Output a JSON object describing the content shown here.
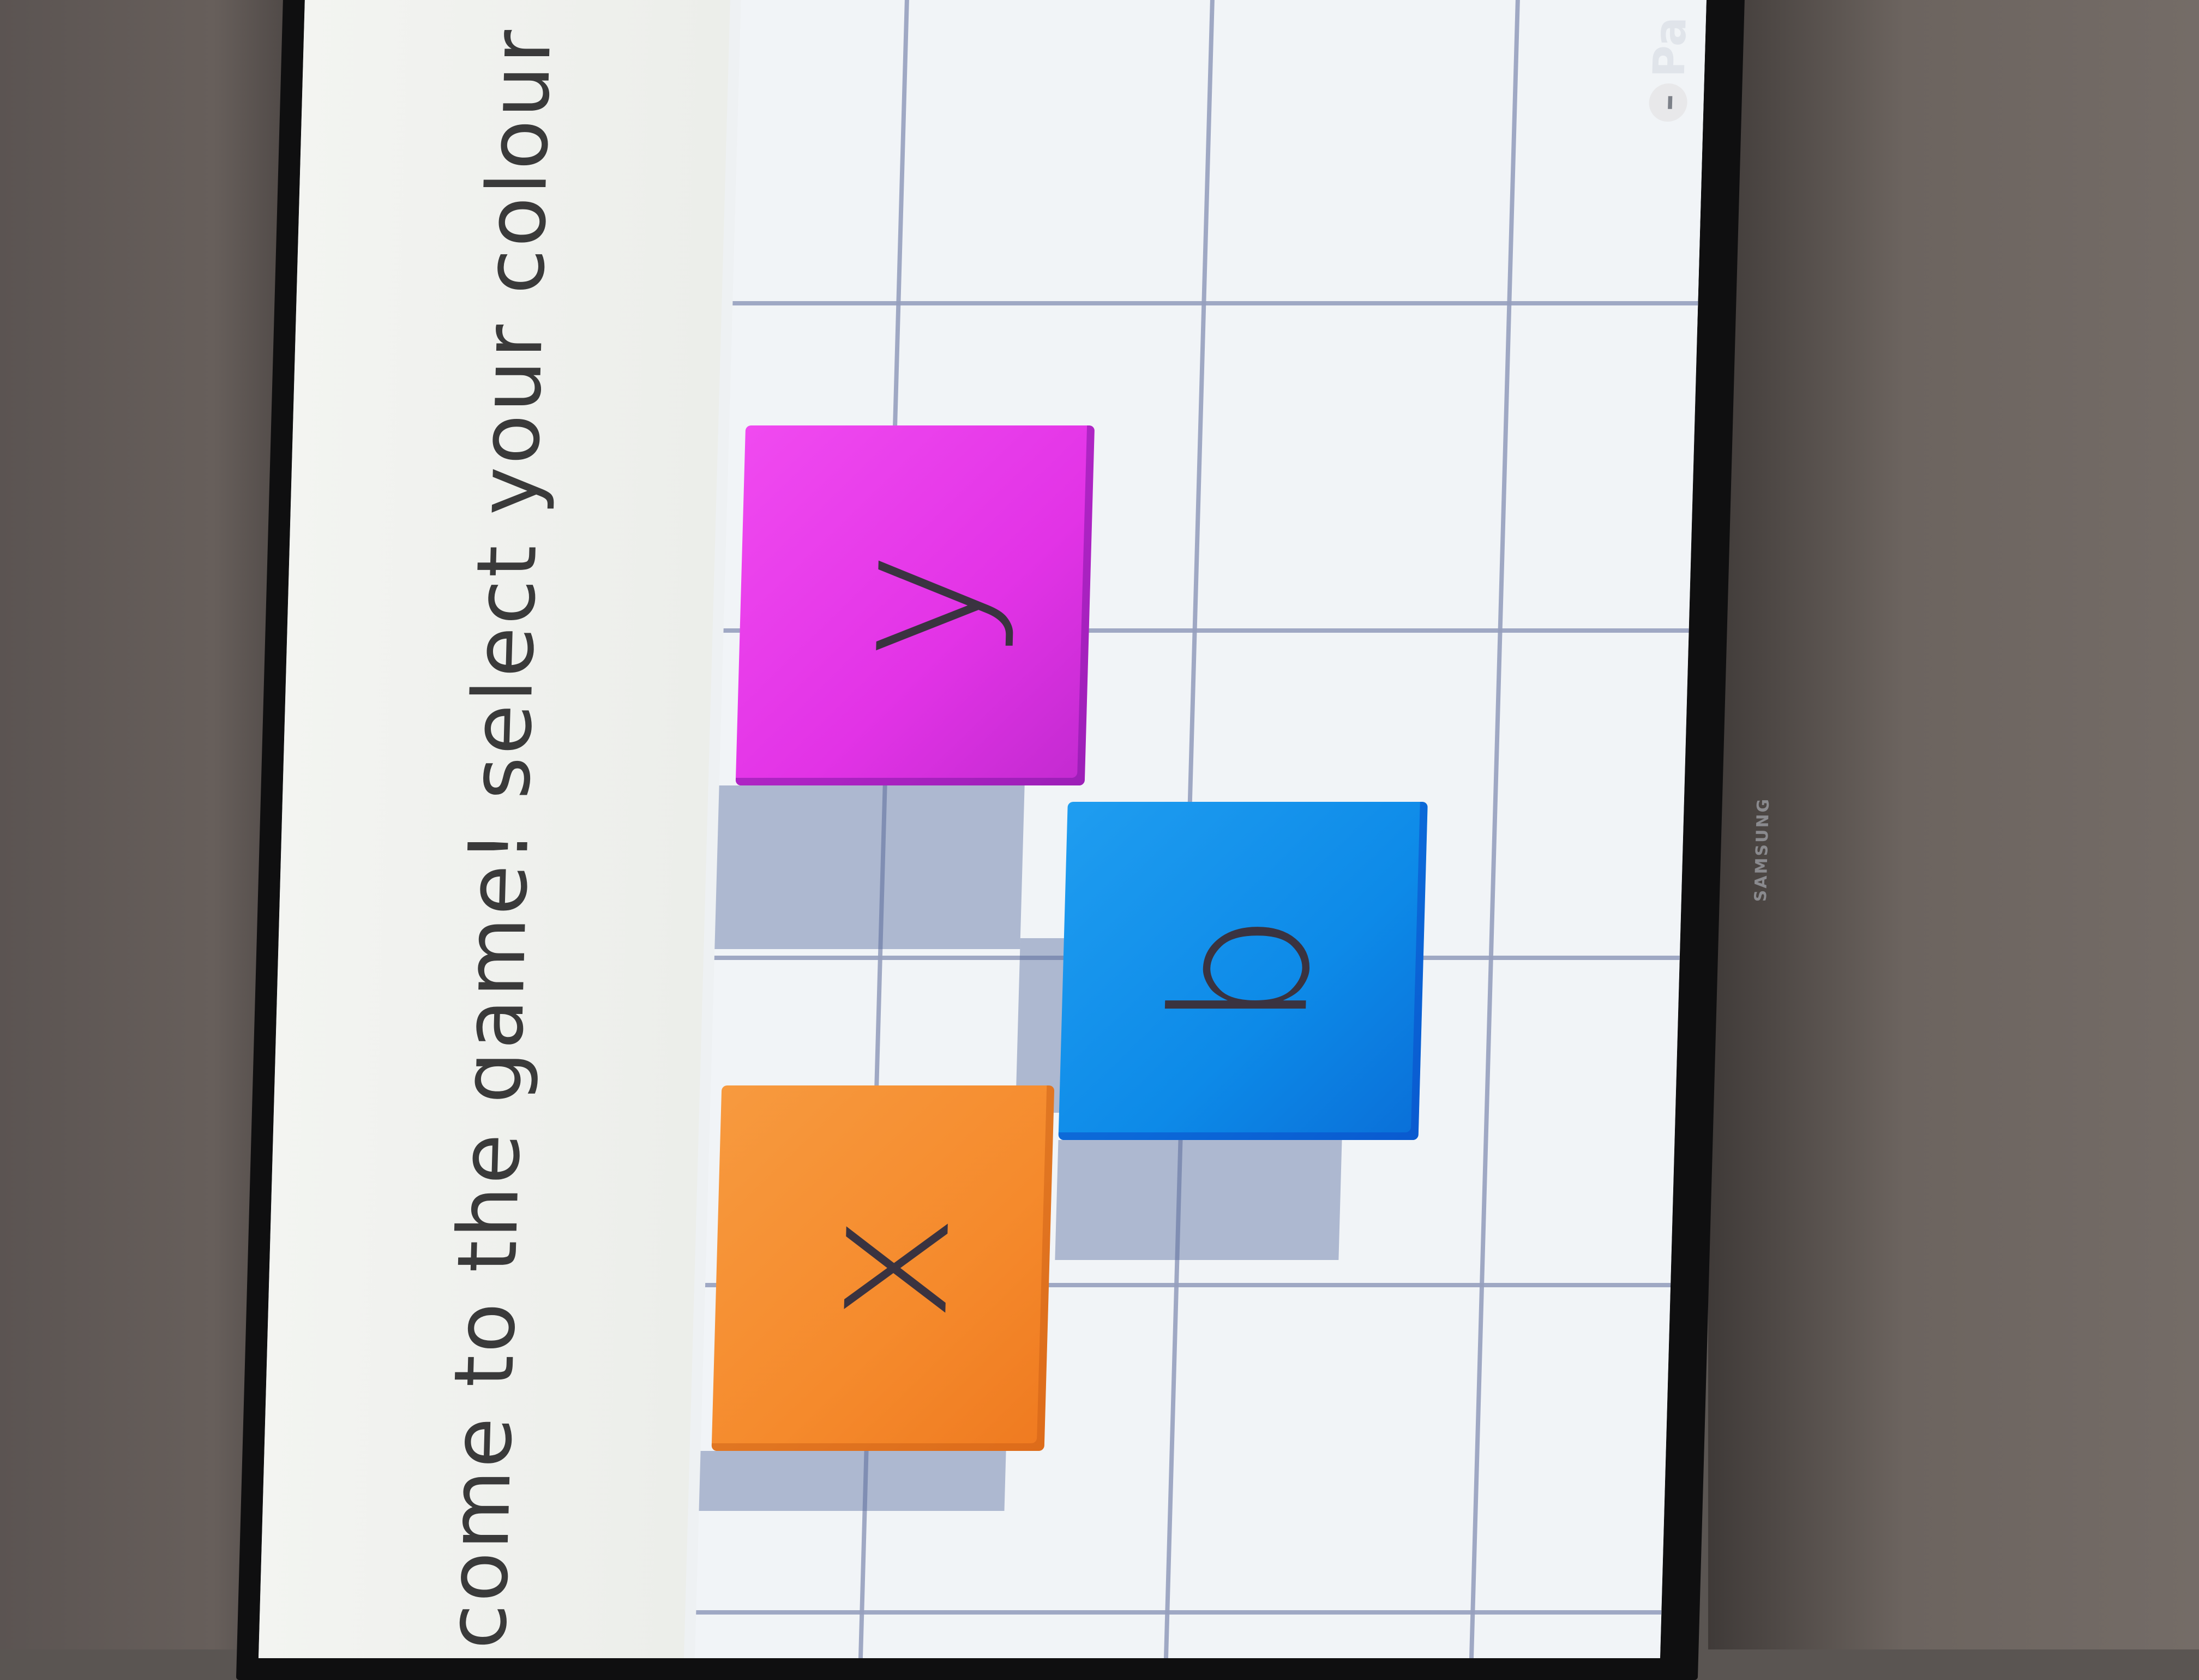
{
  "screen": {
    "title": "lcome to the game! select your colour",
    "pause_label": "Pa",
    "pause_icon": "minus-button-icon"
  },
  "blocks": [
    {
      "letter": "y",
      "color": "#e233e6"
    },
    {
      "letter": "b",
      "color": "#0d8ae8"
    },
    {
      "letter": "x",
      "color": "#f58a2c"
    }
  ],
  "tv": {
    "brand": "SAMSUNG"
  }
}
